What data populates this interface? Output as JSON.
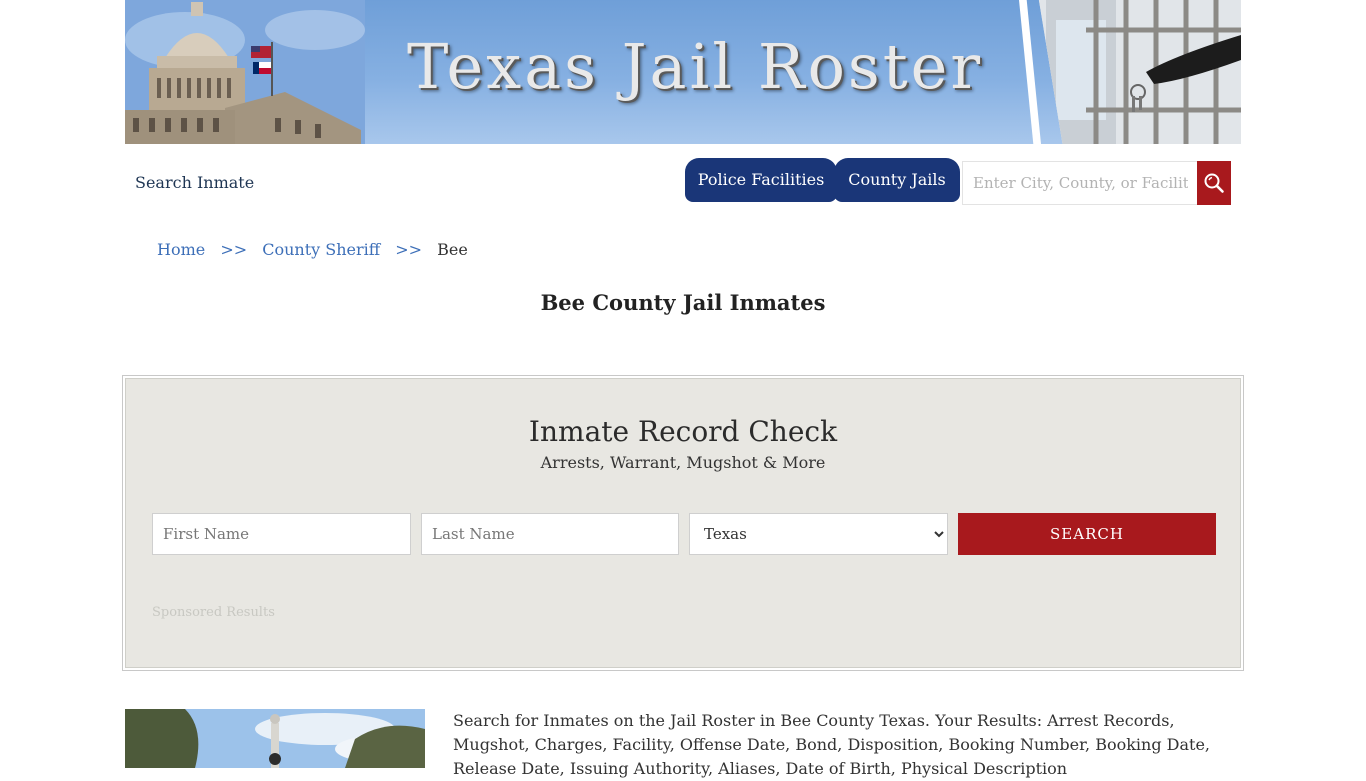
{
  "banner": {
    "title": "Texas Jail Roster"
  },
  "nav": {
    "search_inmate": "Search Inmate",
    "police_facilities": "Police Facilities",
    "county_jails": "County Jails",
    "site_search_placeholder": "Enter City, County, or Facility",
    "search_icon": "magnifier-icon"
  },
  "breadcrumb": {
    "items": [
      "Home",
      "County Sheriff",
      "Bee"
    ],
    "separator": ">>"
  },
  "page_title": "Bee County Jail Inmates",
  "record_check": {
    "title": "Inmate Record Check",
    "subtitle": "Arrests, Warrant, Mugshot & More",
    "first_name_placeholder": "First Name",
    "last_name_placeholder": "Last Name",
    "state_selected": "Texas",
    "search_label": "SEARCH",
    "sponsored": "Sponsored Results"
  },
  "description": "Search for Inmates on the Jail Roster in Bee County Texas. Your Results: Arrest Records, Mugshot, Charges, Facility, Offense Date, Bond, Disposition, Booking Number, Booking Date, Release Date, Issuing Authority, Aliases, Date of Birth, Physical Description",
  "colors": {
    "nav_blue": "#1a3678",
    "accent_red": "#a8191d",
    "link_blue": "#3d6fb8",
    "panel_bg": "#e8e7e2"
  }
}
